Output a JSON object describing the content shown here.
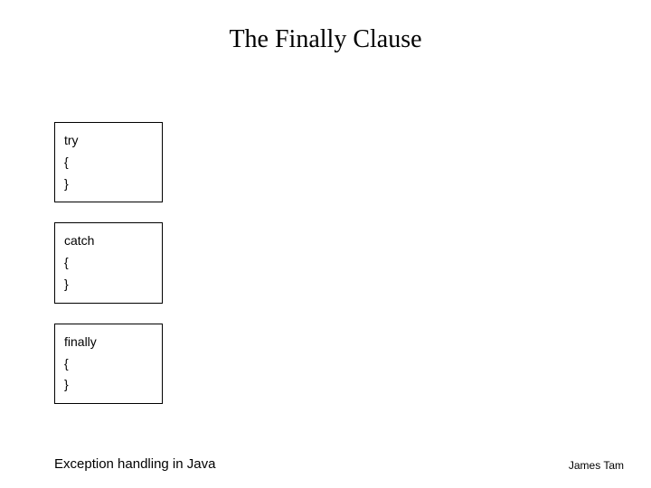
{
  "title": "The Finally Clause",
  "blocks": [
    {
      "keyword": "try",
      "open": "{",
      "close": "}"
    },
    {
      "keyword": "catch",
      "open": "{",
      "close": "}"
    },
    {
      "keyword": "finally",
      "open": "{",
      "close": "}"
    }
  ],
  "footer": {
    "left": "Exception handling in Java",
    "right": "James Tam"
  }
}
